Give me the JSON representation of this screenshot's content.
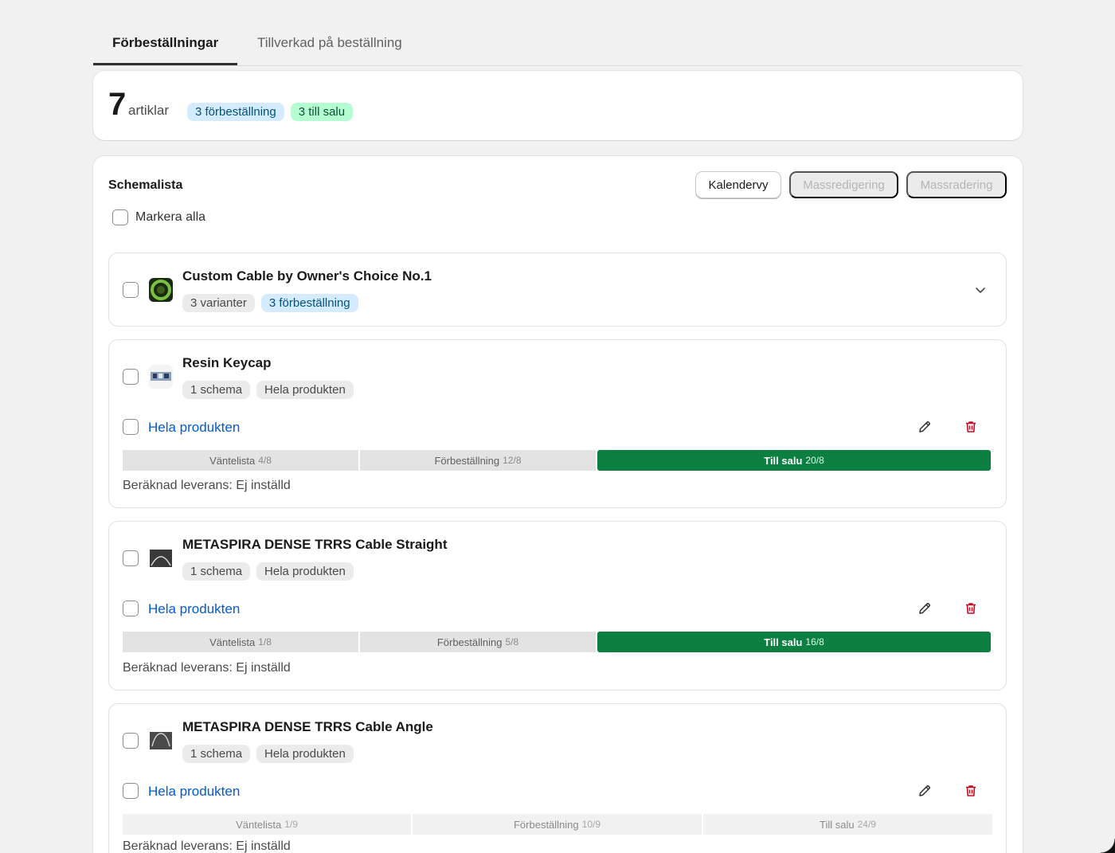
{
  "tabs": [
    {
      "label": "Förbeställningar",
      "active": true
    },
    {
      "label": "Tillverkad på beställning",
      "active": false
    }
  ],
  "summary": {
    "count": "7",
    "unit": "artiklar",
    "badges": [
      "3 förbeställning",
      "3 till salu"
    ]
  },
  "schedule": {
    "title": "Schemalista",
    "buttons": {
      "calendar": "Kalendervy",
      "bulk_edit": "Massredigering",
      "bulk_delete": "Massradering"
    },
    "select_all": "Markera alla"
  },
  "items": [
    {
      "title": "Custom Cable by Owner's Choice No.1",
      "badges": [
        "3 varianter",
        "3 förbeställning"
      ]
    },
    {
      "title": "Resin Keycap",
      "badges": [
        "1 schema",
        "Hela produkten"
      ],
      "schedule_label": "Hela produkten",
      "phases": [
        {
          "name": "Väntelista",
          "date": "4/8"
        },
        {
          "name": "Förbeställning",
          "date": "12/8"
        },
        {
          "name": "Till salu",
          "date": "20/8"
        }
      ],
      "delivery": "Beräknad leverans: Ej inställd"
    },
    {
      "title": "METASPIRA DENSE TRRS Cable Straight",
      "badges": [
        "1 schema",
        "Hela produkten"
      ],
      "schedule_label": "Hela produkten",
      "phases": [
        {
          "name": "Väntelista",
          "date": "1/8"
        },
        {
          "name": "Förbeställning",
          "date": "5/8"
        },
        {
          "name": "Till salu",
          "date": "16/8"
        }
      ],
      "delivery": "Beräknad leverans: Ej inställd"
    },
    {
      "title": "METASPIRA DENSE TRRS Cable Angle",
      "badges": [
        "1 schema",
        "Hela produkten"
      ],
      "schedule_label": "Hela produkten",
      "phases": [
        {
          "name": "Väntelista",
          "date": "1/9"
        },
        {
          "name": "Förbeställning",
          "date": "10/9"
        },
        {
          "name": "Till salu",
          "date": "24/9"
        }
      ],
      "delivery": "Beräknad leverans: Ej inställd"
    }
  ],
  "icons": {
    "expand": "chevron-down-icon",
    "edit": "pencil-icon",
    "delete": "trash-icon"
  },
  "colors": {
    "active_phase": "#0c8041",
    "link": "#005bd3",
    "delete": "#c70a24",
    "badge_blue": "#d5ebff",
    "badge_green": "#b4fed2"
  }
}
